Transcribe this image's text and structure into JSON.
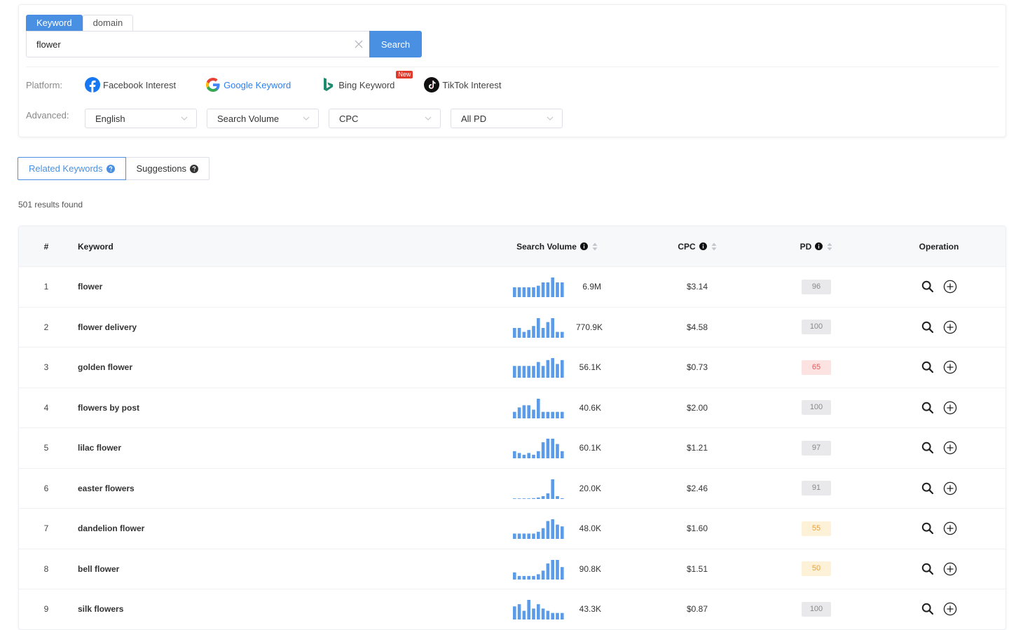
{
  "search": {
    "tabs": [
      {
        "label": "Keyword",
        "active": true
      },
      {
        "label": "domain",
        "active": false
      }
    ],
    "value": "flower",
    "button_label": "Search"
  },
  "platform": {
    "label": "Platform:",
    "items": [
      {
        "label": "Facebook Interest",
        "icon": "facebook-icon",
        "active": false
      },
      {
        "label": "Google Keyword",
        "icon": "google-icon",
        "active": true
      },
      {
        "label": "Bing Keyword",
        "icon": "bing-icon",
        "active": false,
        "badge": "New"
      },
      {
        "label": "TikTok Interest",
        "icon": "tiktok-icon",
        "active": false
      }
    ]
  },
  "advanced": {
    "label": "Advanced:",
    "selects": [
      "English",
      "Search Volume",
      "CPC",
      "All PD"
    ]
  },
  "result_tabs": [
    {
      "label": "Related Keywords",
      "active": true
    },
    {
      "label": "Suggestions",
      "active": false
    }
  ],
  "results_count": "501 results found",
  "table": {
    "headers": {
      "num": "#",
      "keyword": "Keyword",
      "volume": "Search Volume",
      "cpc": "CPC",
      "pd": "PD",
      "operation": "Operation"
    },
    "rows": [
      {
        "num": "1",
        "keyword": "flower",
        "volume": "6.9M",
        "cpc": "$3.14",
        "pd": "96",
        "pd_level": "gray",
        "trend": [
          6,
          6,
          6,
          6,
          6,
          7,
          9,
          9,
          12,
          9,
          9
        ]
      },
      {
        "num": "2",
        "keyword": "flower delivery",
        "volume": "770.9K",
        "cpc": "$4.58",
        "pd": "100",
        "pd_level": "gray",
        "trend": [
          5,
          5,
          3,
          4,
          6,
          10,
          5,
          8,
          10,
          3,
          3
        ]
      },
      {
        "num": "3",
        "keyword": "golden flower",
        "volume": "56.1K",
        "cpc": "$0.73",
        "pd": "65",
        "pd_level": "red",
        "trend": [
          6,
          6,
          6,
          6,
          6,
          8,
          6,
          9,
          10,
          7,
          9
        ]
      },
      {
        "num": "4",
        "keyword": "flowers by post",
        "volume": "40.6K",
        "cpc": "$2.00",
        "pd": "100",
        "pd_level": "gray",
        "trend": [
          3,
          5,
          6,
          6,
          4,
          9,
          3,
          3,
          3,
          3,
          3
        ]
      },
      {
        "num": "5",
        "keyword": "lilac flower",
        "volume": "60.1K",
        "cpc": "$1.21",
        "pd": "97",
        "pd_level": "gray",
        "trend": [
          4,
          3,
          2,
          3,
          2,
          4,
          9,
          11,
          11,
          8,
          4
        ]
      },
      {
        "num": "6",
        "keyword": "easter flowers",
        "volume": "20.0K",
        "cpc": "$2.46",
        "pd": "91",
        "pd_level": "gray",
        "trend": [
          0.3,
          0.3,
          0.3,
          0.4,
          0.6,
          1,
          2,
          4,
          14,
          2,
          0.5
        ]
      },
      {
        "num": "7",
        "keyword": "dandelion flower",
        "volume": "48.0K",
        "cpc": "$1.60",
        "pd": "55",
        "pd_level": "orange",
        "trend": [
          3,
          3,
          3,
          3,
          3,
          4,
          6,
          10,
          11,
          8,
          7
        ]
      },
      {
        "num": "8",
        "keyword": "bell flower",
        "volume": "90.8K",
        "cpc": "$1.51",
        "pd": "50",
        "pd_level": "orange",
        "trend": [
          4,
          2,
          2,
          2,
          2,
          3,
          5,
          9,
          11,
          11,
          7
        ]
      },
      {
        "num": "9",
        "keyword": "silk flowers",
        "volume": "43.3K",
        "cpc": "$0.87",
        "pd": "100",
        "pd_level": "gray",
        "trend": [
          6,
          7,
          4,
          9,
          5,
          7,
          5,
          4,
          3,
          3,
          3
        ]
      }
    ]
  },
  "colors": {
    "accent": "#4a90e2",
    "spark": "#5b9be8"
  }
}
